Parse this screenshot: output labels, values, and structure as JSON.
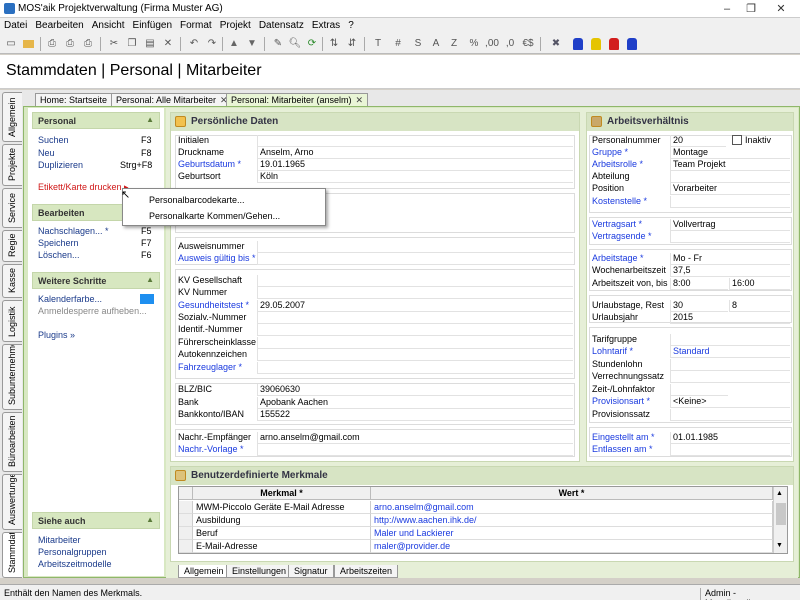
{
  "window": {
    "title": "MOS'aik Projektverwaltung (Firma Muster AG)",
    "minimize": "–",
    "maximize": "❐",
    "close": "✕"
  },
  "menu": [
    "Datei",
    "Bearbeiten",
    "Ansicht",
    "Einfügen",
    "Format",
    "Projekt",
    "Datensatz",
    "Extras",
    "?"
  ],
  "toolbar": {
    "icons": [
      "new-icon",
      "open-icon",
      "print-icon",
      "print-preview-icon",
      "cut-icon",
      "copy-icon",
      "paste-icon",
      "delete-icon",
      "undo-icon",
      "redo-icon",
      "arrow-up-icon",
      "arrow-down-icon",
      "pencil-icon",
      "find-icon",
      "refresh-icon",
      "sort-icon",
      "text-format-icon",
      "number-format-icon",
      "date-format-icon",
      "percent-format-icon",
      "currency-format-icon",
      "tools-icon",
      "user-blue-icon",
      "user-yellow-icon",
      "user-red-icon",
      "lock-icon"
    ],
    "glyphs": [
      "T",
      "#",
      "S",
      "A",
      "Z",
      "%",
      "$"
    ]
  },
  "header": {
    "title": "Stammdaten | Personal | Mitarbeiter"
  },
  "vtabs": [
    "Allgemein",
    "Projekte",
    "Service",
    "Regie",
    "Kasse",
    "Logistik",
    "Subunternehmer",
    "Büroarbeiten",
    "Auswertungen",
    "Stammdaten"
  ],
  "doctabs": [
    "Home: Startseite",
    "Personal: Alle Mitarbeiter",
    "Personal: Mitarbeiter (anselm)"
  ],
  "left": {
    "personal": {
      "title": "Personal",
      "items": [
        {
          "label": "Suchen",
          "key": "F3"
        },
        {
          "label": "Neu",
          "key": "F8"
        },
        {
          "label": "Duplizieren",
          "key": "Strg+F8"
        }
      ],
      "print": "Etikett/Karte drucken ▸"
    },
    "bearbeiten": {
      "title": "Bearbeiten",
      "items": [
        {
          "label": "Nachschlagen... *",
          "key": "F5"
        },
        {
          "label": "Speichern",
          "key": "F7"
        },
        {
          "label": "Löschen...",
          "key": "F6"
        }
      ]
    },
    "weitere": {
      "title": "Weitere Schritte",
      "items": [
        "Kalenderfarbe...",
        "Anmeldesperre aufheben...",
        "Plugins »"
      ],
      "calendar_color": "#1e8ff0"
    },
    "siehe": {
      "title": "Siehe auch",
      "items": [
        "Mitarbeiter",
        "Personalgruppen",
        "Arbeitszeitmodelle"
      ]
    }
  },
  "popup": [
    "Personalbarcodekarte...",
    "Personalkarte Kommen/Gehen..."
  ],
  "pd": {
    "title": "Persönliche Daten",
    "g1": [
      [
        "Initialen",
        ""
      ],
      [
        "Druckname",
        "Anselm, Arno"
      ],
      [
        "Geburtsdatum *",
        "19.01.1965"
      ],
      [
        "Geburtsort",
        "Köln"
      ]
    ],
    "g3": [
      [
        "Ausweisnummer",
        ""
      ],
      [
        "Ausweis gültig bis *",
        ""
      ]
    ],
    "g4": [
      [
        "KV Gesellschaft",
        ""
      ],
      [
        "KV Nummer",
        ""
      ],
      [
        "Gesundheitstest *",
        "29.05.2007"
      ],
      [
        "Sozialv.-Nummer",
        ""
      ],
      [
        "Identif.-Nummer",
        ""
      ],
      [
        "Führerscheinklasse",
        ""
      ],
      [
        "Autokennzeichen",
        ""
      ],
      [
        "Fahrzeuglager *",
        ""
      ]
    ],
    "g5": [
      [
        "BLZ/BIC",
        "39060630"
      ],
      [
        "Bank",
        "Apobank Aachen"
      ],
      [
        "Bankkonto/IBAN",
        "155522"
      ]
    ],
    "g6": [
      [
        "Nachr.-Empfänger",
        "arno.anselm@gmail.com"
      ],
      [
        "Nachr.-Vorlage *",
        ""
      ]
    ]
  },
  "av": {
    "title": "Arbeitsverhältnis",
    "inaktiv": "Inaktiv",
    "g1": [
      [
        "Personalnummer",
        "20"
      ],
      [
        "Gruppe *",
        "Montage"
      ],
      [
        "Arbeitsrolle *",
        "Team Projekt"
      ],
      [
        "Abteilung",
        ""
      ],
      [
        "Position",
        "Vorarbeiter"
      ],
      [
        "Kostenstelle *",
        ""
      ]
    ],
    "g2": [
      [
        "Vertragsart *",
        "Vollvertrag"
      ],
      [
        "Vertragsende *",
        ""
      ]
    ],
    "g3": [
      [
        "Arbeitstage *",
        "Mo - Fr"
      ],
      [
        "Wochenarbeitszeit",
        "37,5"
      ],
      [
        "Arbeitszeit von, bis",
        "8:00",
        "16:00"
      ]
    ],
    "g4": [
      [
        "Urlaubstage, Rest",
        "30",
        "8"
      ],
      [
        "Urlaubsjahr",
        "2015"
      ]
    ],
    "g5": [
      [
        "Tarifgruppe",
        ""
      ],
      [
        "Lohntarif *",
        "Standard"
      ],
      [
        "Stundenlohn",
        ""
      ],
      [
        "Verrechnungssatz",
        ""
      ],
      [
        "Zeit-/Lohnfaktor",
        ""
      ],
      [
        "Provisionsart *",
        "<Keine>"
      ],
      [
        "Provisionssatz",
        ""
      ]
    ],
    "g6": [
      [
        "Eingestellt am *",
        "01.01.1985"
      ],
      [
        "Entlassen am *",
        ""
      ]
    ]
  },
  "bm": {
    "title": "Benutzerdefinierte Merkmale",
    "headers": [
      "Merkmal *",
      "Wert *"
    ],
    "rows": [
      [
        "MWM-Piccolo Geräte E-Mail Adresse",
        "arno.anselm@gmail.com"
      ],
      [
        "Ausbildung",
        "http://www.aachen.ihk.de/"
      ],
      [
        "Beruf",
        "Maler und Lackierer"
      ],
      [
        "E-Mail-Adresse",
        "maler@provider.de"
      ]
    ]
  },
  "bottomtabs": [
    "Allgemein",
    "Einstellungen",
    "Signatur",
    "Arbeitszeiten"
  ],
  "status": {
    "left": "Enthält den Namen des Merkmals.",
    "right": "Admin - Mosaik.mdb"
  }
}
